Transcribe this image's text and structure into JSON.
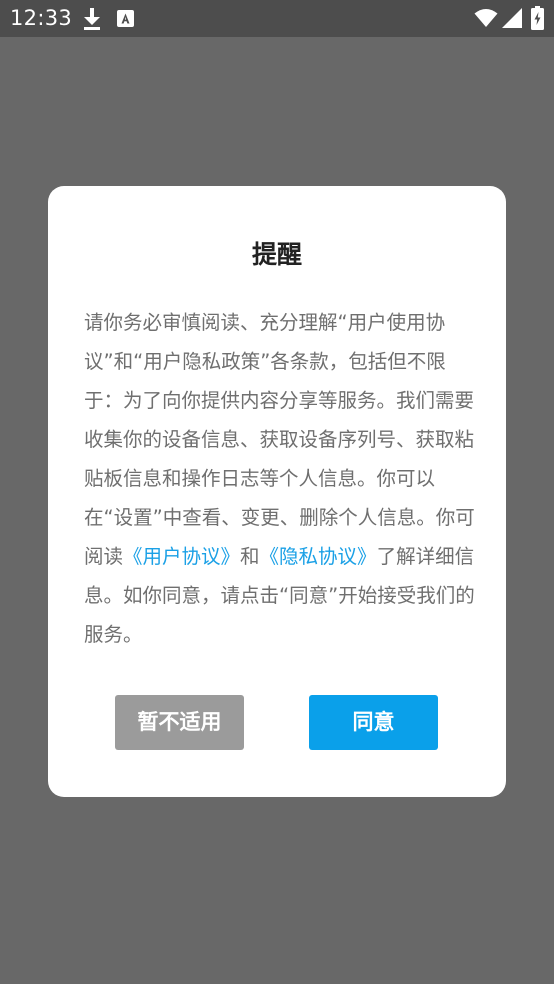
{
  "status_bar": {
    "time": "12:33",
    "icons": [
      "download-icon",
      "font-app-icon",
      "wifi-icon",
      "cell-signal-icon",
      "battery-icon"
    ]
  },
  "dialog": {
    "title": "提醒",
    "body": {
      "part1": "请你务必审慎阅读、充分理解“用户使用协议”和“用户隐私政策”各条款，包括但不限于：为了向你提供内容分享等服务。我们需要收集你的设备信息、获取设备序列号、获取粘贴板信息和操作日志等个人信息。你可以在“设置”中查看、变更、删除个人信息。你可阅读",
      "link1": "《用户协议》",
      "part2": "和",
      "link2": "《隐私协议》",
      "part3": "了解详细信息。如你同意，请点击“同意”开始接受我们的服务。"
    },
    "buttons": {
      "decline": "暂不适用",
      "agree": "同意"
    }
  },
  "colors": {
    "overlay": "#686868",
    "status_bar": "#4d4d4d",
    "dialog_bg": "#ffffff",
    "title_text": "#222222",
    "body_text": "#6f6f6f",
    "link": "#1aa0e6",
    "decline_button": "#9b9b9b",
    "agree_button": "#0aa0ea"
  }
}
